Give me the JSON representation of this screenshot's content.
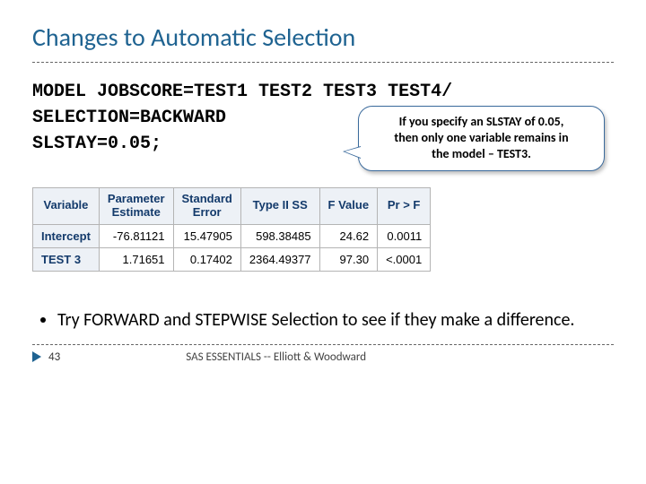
{
  "title": "Changes to Automatic Selection",
  "code": {
    "line1": "MODEL JOBSCORE=TEST1 TEST2 TEST3 TEST4/",
    "line2": "SELECTION=BACKWARD",
    "line3": "SLSTAY=0.05;"
  },
  "callout": {
    "line1": "If you specify an SLSTAY of 0.05,",
    "line2": "then only one variable remains in",
    "line3": "the model – TEST3."
  },
  "table": {
    "headers": {
      "variable": "Variable",
      "estimate": "Parameter\nEstimate",
      "stderr": "Standard\nError",
      "typeii": "Type II SS",
      "fvalue": "F Value",
      "prf": "Pr > F"
    },
    "rows": [
      {
        "variable": "Intercept",
        "estimate": "-76.81121",
        "stderr": "15.47905",
        "typeii": "598.38485",
        "fvalue": "24.62",
        "prf": "0.0011"
      },
      {
        "variable": "TEST 3",
        "estimate": "1.71651",
        "stderr": "0.17402",
        "typeii": "2364.49377",
        "fvalue": "97.30",
        "prf": "<.0001"
      }
    ]
  },
  "bullet": "Try FORWARD and STEPWISE Selection to see if they make a difference.",
  "footer": {
    "page": "43",
    "source": "SAS ESSENTIALS -- Elliott & Woodward"
  }
}
